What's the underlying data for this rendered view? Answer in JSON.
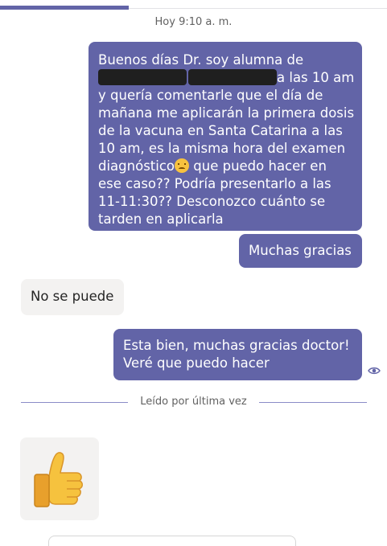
{
  "conversation": {
    "timestamp": "Hoy 9:10 a. m.",
    "messages": [
      {
        "sender": "me",
        "lines": [
          "Buenos días Dr. soy alumna de",
          "a las 10 am",
          "y quería comentarle que el día de",
          "mañana me aplicarán la primera dosis",
          "de la vacuna en Santa Catarina a las",
          "10 am, es la misma hora del examen",
          "diagnóstico",
          "que puedo hacer en",
          "ese caso?? Podría presentarlo a las",
          "11-11:30?? Desconozco cuánto se",
          "tarden en aplicarla"
        ]
      },
      {
        "sender": "me",
        "text": "Muchas gracias"
      },
      {
        "sender": "them",
        "text": "No se puede"
      },
      {
        "sender": "me",
        "lines": [
          "Esta bien, muchas gracias doctor!",
          "Veré que puedo hacer"
        ]
      }
    ],
    "read_receipt": "Leído por última vez",
    "sticker": "thumbs-up"
  },
  "colors": {
    "accent": "#6264a7",
    "sent_bubble": "#6264a7",
    "received_bubble": "#f3f2f1"
  }
}
